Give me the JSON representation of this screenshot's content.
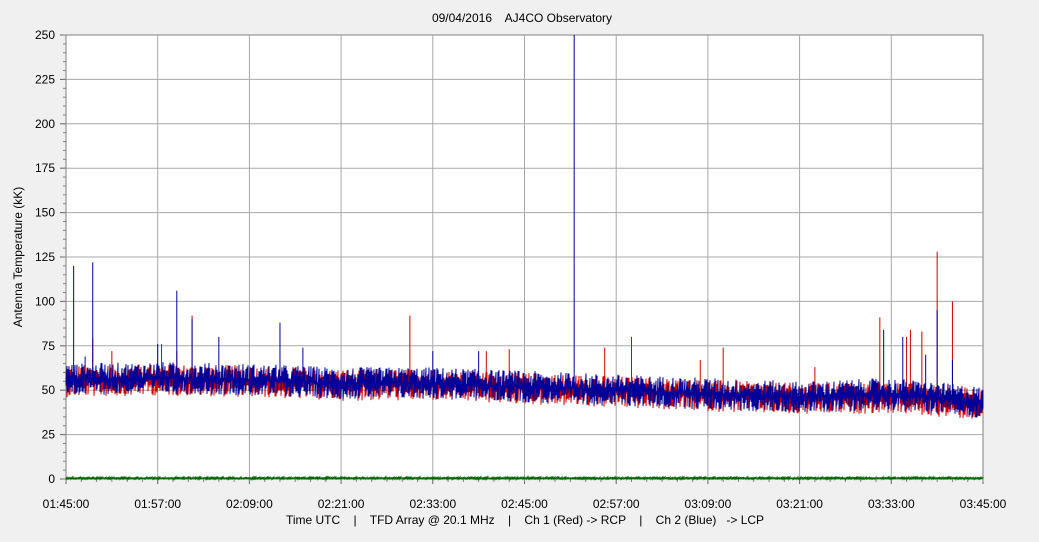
{
  "chart_data": {
    "type": "line",
    "title": "09/04/2016    AJ4CO Observatory",
    "ylabel": "Antenna Temperature (kK)",
    "xlabel": "Time UTC    |    TFD Array @ 20.1 MHz    |    Ch 1 (Red) -> RCP    |    Ch 2 (Blue)   -> LCP",
    "x_range": [
      "01:45:00",
      "03:45:00"
    ],
    "ylim": [
      0,
      250
    ],
    "grid": true,
    "x_ticks": [
      "01:45:00",
      "01:57:00",
      "02:09:00",
      "02:21:00",
      "02:33:00",
      "02:45:00",
      "02:57:00",
      "03:09:00",
      "03:21:00",
      "03:33:00",
      "03:45:00"
    ],
    "y_ticks": [
      "0",
      "25",
      "50",
      "75",
      "100",
      "125",
      "150",
      "175",
      "200",
      "225",
      "250"
    ],
    "series": [
      {
        "name": "Ch 1 (Red) -> RCP",
        "color": "#cc0000",
        "baseline": [
          {
            "x": "01:45:00",
            "y": 55
          },
          {
            "x": "01:57:00",
            "y": 56
          },
          {
            "x": "02:09:00",
            "y": 55
          },
          {
            "x": "02:21:00",
            "y": 53
          },
          {
            "x": "02:33:00",
            "y": 53
          },
          {
            "x": "02:45:00",
            "y": 51
          },
          {
            "x": "02:57:00",
            "y": 49
          },
          {
            "x": "03:09:00",
            "y": 47
          },
          {
            "x": "03:21:00",
            "y": 45
          },
          {
            "x": "03:33:00",
            "y": 46
          },
          {
            "x": "03:45:00",
            "y": 42
          }
        ],
        "spikes": [
          {
            "x": "01:48:30",
            "y": 79
          },
          {
            "x": "01:51:00",
            "y": 72
          },
          {
            "x": "01:57:30",
            "y": 76
          },
          {
            "x": "01:59:30",
            "y": 72
          },
          {
            "x": "02:01:30",
            "y": 92
          },
          {
            "x": "02:30:00",
            "y": 92
          },
          {
            "x": "02:40:00",
            "y": 72
          },
          {
            "x": "02:43:00",
            "y": 73
          },
          {
            "x": "02:55:30",
            "y": 74
          },
          {
            "x": "02:59:00",
            "y": 80
          },
          {
            "x": "03:08:00",
            "y": 67
          },
          {
            "x": "03:11:00",
            "y": 74
          },
          {
            "x": "03:23:00",
            "y": 63
          },
          {
            "x": "03:31:30",
            "y": 91
          },
          {
            "x": "03:35:00",
            "y": 80
          },
          {
            "x": "03:35:30",
            "y": 84
          },
          {
            "x": "03:37:00",
            "y": 83
          },
          {
            "x": "03:39:00",
            "y": 128
          },
          {
            "x": "03:41:00",
            "y": 100
          }
        ]
      },
      {
        "name": "Ch 2 (Blue)   -> LCP",
        "color": "#000099",
        "baseline": [
          {
            "x": "01:45:00",
            "y": 56
          },
          {
            "x": "01:57:00",
            "y": 57
          },
          {
            "x": "02:09:00",
            "y": 56
          },
          {
            "x": "02:21:00",
            "y": 54
          },
          {
            "x": "02:33:00",
            "y": 54
          },
          {
            "x": "02:45:00",
            "y": 52
          },
          {
            "x": "02:57:00",
            "y": 50
          },
          {
            "x": "03:09:00",
            "y": 48
          },
          {
            "x": "03:21:00",
            "y": 46
          },
          {
            "x": "03:33:00",
            "y": 48
          },
          {
            "x": "03:45:00",
            "y": 43
          }
        ],
        "spikes": [
          {
            "x": "01:46:00",
            "y": 120
          },
          {
            "x": "01:47:30",
            "y": 69
          },
          {
            "x": "01:48:30",
            "y": 122
          },
          {
            "x": "01:57:00",
            "y": 76
          },
          {
            "x": "01:59:30",
            "y": 106
          },
          {
            "x": "02:01:30",
            "y": 90
          },
          {
            "x": "02:05:00",
            "y": 80
          },
          {
            "x": "02:13:00",
            "y": 88
          },
          {
            "x": "02:16:00",
            "y": 74
          },
          {
            "x": "02:33:00",
            "y": 72
          },
          {
            "x": "02:39:00",
            "y": 72
          },
          {
            "x": "02:51:30",
            "y": 250
          },
          {
            "x": "03:32:00",
            "y": 84
          },
          {
            "x": "03:34:30",
            "y": 80
          },
          {
            "x": "03:37:30",
            "y": 70
          },
          {
            "x": "03:39:00",
            "y": 95
          },
          {
            "x": "03:41:00",
            "y": 67
          }
        ]
      },
      {
        "name": "",
        "color": "#006600",
        "baseline": [
          {
            "x": "01:45:00",
            "y": 0.5
          },
          {
            "x": "03:45:00",
            "y": 0.5
          }
        ],
        "spikes": []
      }
    ]
  }
}
